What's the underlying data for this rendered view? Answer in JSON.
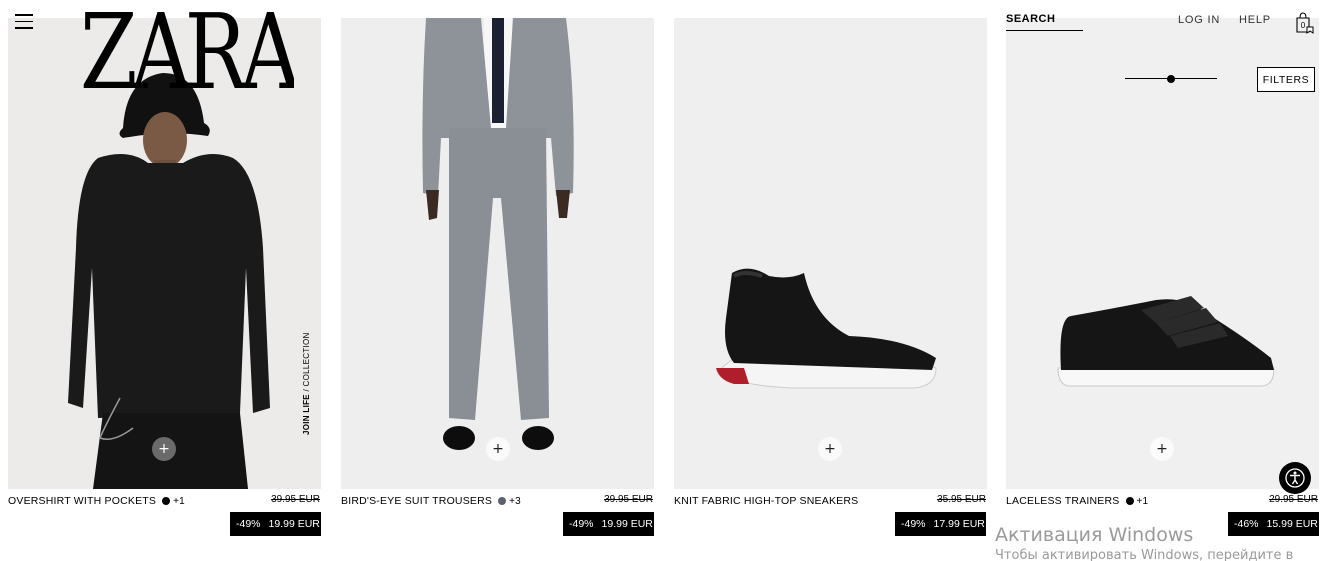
{
  "header": {
    "logo_text": "ZARA",
    "search_label": "SEARCH",
    "login_label": "LOG IN",
    "help_label": "HELP",
    "bag_count": "0"
  },
  "toolbar": {
    "filters_label": "FILTERS",
    "grid_slider_level": 0.5
  },
  "products": [
    {
      "name": "OVERSHIRT WITH POCKETS",
      "swatch_color": "#000000",
      "more_colors": "+1",
      "old_price": "39.95 EUR",
      "discount": "-49%",
      "price": "19.99 EUR"
    },
    {
      "name": "BIRD'S-EYE SUIT TROUSERS",
      "swatch_color": "#5b6170",
      "more_colors": "+3",
      "old_price": "39.95 EUR",
      "discount": "-49%",
      "price": "19.99 EUR"
    },
    {
      "name": "KNIT FABRIC HIGH-TOP SNEAKERS",
      "swatch_color": "",
      "more_colors": "",
      "old_price": "35.95 EUR",
      "discount": "-49%",
      "price": "17.99 EUR"
    },
    {
      "name": "LACELESS TRAINERS",
      "swatch_color": "#000000",
      "more_colors": "+1",
      "old_price": "29.95 EUR",
      "discount": "-46%",
      "price": "15.99 EUR"
    }
  ],
  "badges": {
    "join_life_bold": "JOIN LIFE",
    "join_life_rest": " / COLLECTION"
  },
  "icons": {
    "menu": "hamburger-menu-icon",
    "bag": "shopping-bag-icon",
    "add": "plus-icon",
    "accessibility": "accessibility-icon"
  },
  "os_overlay": {
    "title": "Активация Windows",
    "subtitle": "Чтобы активировать Windows, перейдите в"
  }
}
